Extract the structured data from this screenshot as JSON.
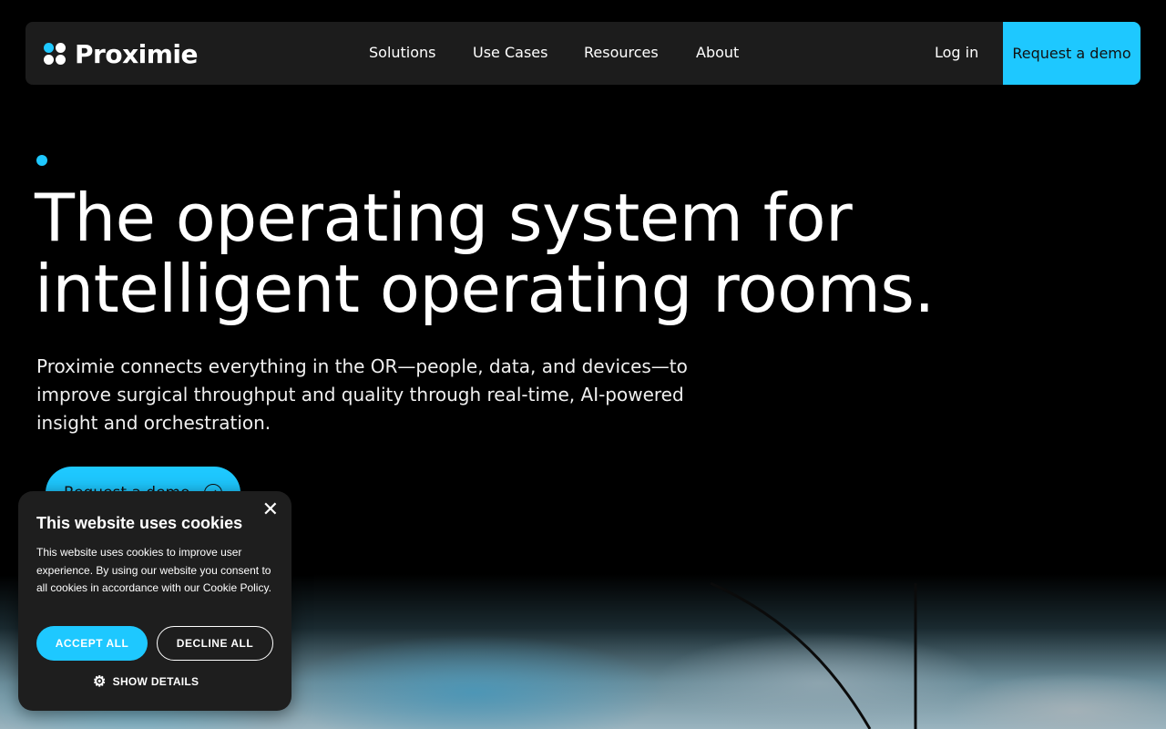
{
  "header": {
    "logo_text": "Proximie",
    "nav": [
      "Solutions",
      "Use Cases",
      "Resources",
      "About"
    ],
    "login_label": "Log in",
    "demo_label": "Request a demo"
  },
  "hero": {
    "title_line1": "The operating system for",
    "title_line2": "intelligent operating rooms.",
    "subtitle": "Proximie connects everything in the OR—people, data, and devices—to improve surgical throughput and quality through real-time, AI-powered insight and orchestration.",
    "cta_label": "Request a demo",
    "cta_icon": "arrow-right-icon"
  },
  "cookie_banner": {
    "title": "This website uses cookies",
    "text": "This website uses cookies to improve user experience. By using our website you consent to all cookies in accordance with our Cookie Policy.",
    "accept_label": "ACCEPT ALL",
    "decline_label": "DECLINE ALL",
    "details_label": "SHOW DETAILS",
    "close_glyph": "✕",
    "details_icon": "gear-icon"
  },
  "colors": {
    "accent": "#1ec8ff",
    "background": "#000000",
    "nav_background": "#1c1c1c",
    "cookie_background": "#1e1e1e"
  }
}
